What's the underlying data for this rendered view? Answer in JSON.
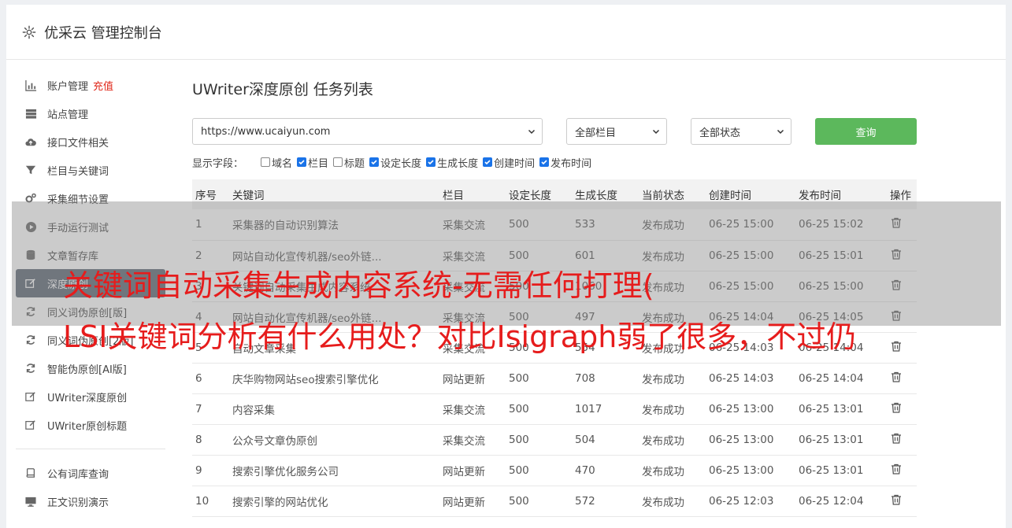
{
  "header": {
    "title": "优采云 管理控制台"
  },
  "sidebar": {
    "items": [
      {
        "label": "账户管理",
        "badge": "充值",
        "icon": "bar-chart-icon"
      },
      {
        "label": "站点管理",
        "icon": "server-icon"
      },
      {
        "label": "接口文件相关",
        "icon": "cloud-upload-icon"
      },
      {
        "label": "栏目与关键词",
        "icon": "filter-icon"
      },
      {
        "label": "采集细节设置",
        "icon": "cogs-icon"
      },
      {
        "label": "手动运行测试",
        "icon": "play-icon"
      },
      {
        "label": "文章暂存库",
        "icon": "database-icon"
      },
      {
        "label": "深度原创",
        "icon": "edit-icon"
      },
      {
        "label": "同义词伪原创[版]",
        "icon": "refresh-icon"
      },
      {
        "label": "同义词伪原创[2版]",
        "icon": "refresh-icon"
      },
      {
        "label": "智能伪原创[AI版]",
        "icon": "refresh-icon"
      },
      {
        "label": "UWriter深度原创",
        "icon": "edit-icon"
      },
      {
        "label": "UWriter原创标题",
        "icon": "edit-icon"
      },
      {
        "label": "公有词库查询",
        "icon": "book-icon"
      },
      {
        "label": "正文识别演示",
        "icon": "monitor-icon"
      }
    ]
  },
  "main": {
    "title": "UWriter深度原创 任务列表",
    "filters": {
      "url": "https://www.ucaiyun.com",
      "column": "全部栏目",
      "status": "全部状态",
      "search_label": "查询"
    },
    "fields": {
      "label": "显示字段：",
      "options": [
        {
          "label": "域名",
          "checked": false
        },
        {
          "label": "栏目",
          "checked": true
        },
        {
          "label": "标题",
          "checked": false
        },
        {
          "label": "设定长度",
          "checked": true
        },
        {
          "label": "生成长度",
          "checked": true
        },
        {
          "label": "创建时间",
          "checked": true
        },
        {
          "label": "发布时间",
          "checked": true
        }
      ]
    },
    "table": {
      "headers": [
        "序号",
        "关键词",
        "栏目",
        "设定长度",
        "生成长度",
        "当前状态",
        "创建时间",
        "发布时间",
        "操作"
      ],
      "rows": [
        [
          "1",
          "采集器的自动识别算法",
          "采集交流",
          "500",
          "533",
          "发布成功",
          "06-25 15:00",
          "06-25 15:02"
        ],
        [
          "2",
          "网站自动化宣传机器/seo外链...",
          "采集交流",
          "500",
          "601",
          "发布成功",
          "06-25 15:00",
          "06-25 15:01"
        ],
        [
          "3",
          "关键词自动采集生成内容系统",
          "采集交流",
          "500",
          "1060",
          "发布成功",
          "06-25 15:00",
          "06-25 15:00"
        ],
        [
          "4",
          "网站自动化宣传机器/seo外链...",
          "采集交流",
          "500",
          "497",
          "发布成功",
          "06-25 14:04",
          "06-25 14:05"
        ],
        [
          "5",
          "自动文章采集",
          "采集交流",
          "500",
          "554",
          "发布成功",
          "06-25 14:03",
          "06-25 14:04"
        ],
        [
          "6",
          "庆华购物网站seo搜索引擎优化",
          "网站更新",
          "500",
          "708",
          "发布成功",
          "06-25 14:03",
          "06-25 14:04"
        ],
        [
          "7",
          "内容采集",
          "采集交流",
          "500",
          "1017",
          "发布成功",
          "06-25 13:00",
          "06-25 13:01"
        ],
        [
          "8",
          "公众号文章伪原创",
          "采集交流",
          "500",
          "504",
          "发布成功",
          "06-25 13:00",
          "06-25 13:01"
        ],
        [
          "9",
          "搜索引擎优化服务公司",
          "网站更新",
          "500",
          "470",
          "发布成功",
          "06-25 13:00",
          "06-25 13:01"
        ],
        [
          "10",
          "搜索引擎的网站优化",
          "网站更新",
          "500",
          "572",
          "发布成功",
          "06-25 12:03",
          "06-25 12:04"
        ]
      ]
    }
  },
  "overlay": {
    "line1": "关键词自动采集生成内容系统-无需任何打理(",
    "line2": "LSI关键词分析有什么用处？对比Isigraph弱了很多，不过仍"
  },
  "colors": {
    "accent": "#5cb85c",
    "success": "#1e9a3c",
    "badge": "#e0281a",
    "headline": "#e61c1c",
    "active_nav": "#5a6472"
  }
}
